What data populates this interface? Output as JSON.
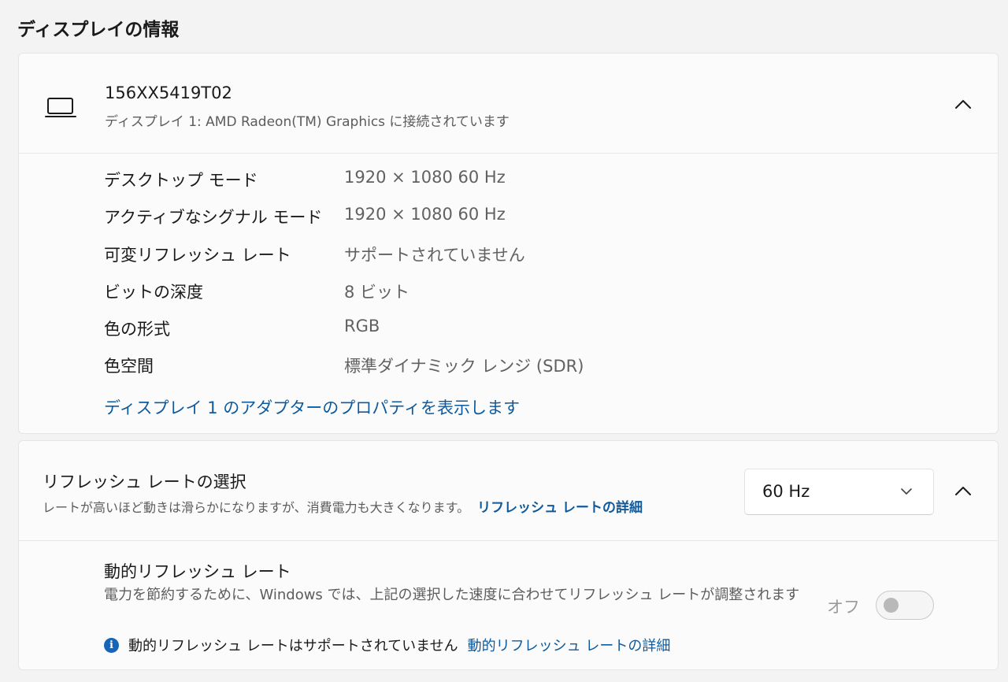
{
  "section_title": "ディスプレイの情報",
  "display_card": {
    "icon": "laptop-icon",
    "monitor_name": "156XX5419T02",
    "monitor_subtitle": "ディスプレイ 1: AMD Radeon(TM) Graphics に接続されています",
    "expanded": true,
    "rows": [
      {
        "label": "デスクトップ モード",
        "value": "1920 × 1080 60 Hz"
      },
      {
        "label": "アクティブなシグナル モード",
        "value": "1920 × 1080 60 Hz"
      },
      {
        "label": "可変リフレッシュ レート",
        "value": "サポートされていません"
      },
      {
        "label": "ビットの深度",
        "value": "8 ビット"
      },
      {
        "label": "色の形式",
        "value": "RGB"
      },
      {
        "label": "色空間",
        "value": "標準ダイナミック レンジ (SDR)"
      }
    ],
    "adapter_link": "ディスプレイ 1 のアダプターのプロパティを表示します"
  },
  "refresh_card": {
    "title": "リフレッシュ レートの選択",
    "description": "レートが高いほど動きは滑らかになりますが、消費電力も大きくなります。",
    "detail_link": "リフレッシュ レートの詳細",
    "selected_rate": "60 Hz",
    "expanded": true,
    "dynamic": {
      "title": "動的リフレッシュ レート",
      "description": "電力を節約するために、Windows では、上記の選択した速度に合わせてリフレッシュ レートが調整されます",
      "note": "動的リフレッシュ レートはサポートされていません",
      "note_link": "動的リフレッシュ レートの詳細",
      "toggle_label": "オフ",
      "toggle_on": false
    }
  },
  "colors": {
    "accent_link": "#0f5a9c",
    "info_icon": "#1565b8",
    "background": "#f3f3f3",
    "card": "#fbfbfb"
  }
}
